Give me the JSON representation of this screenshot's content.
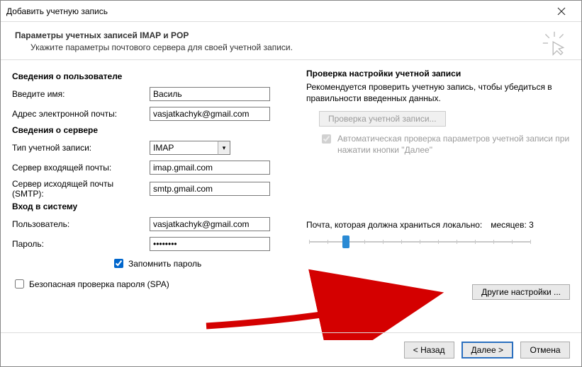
{
  "window_title": "Добавить учетную запись",
  "header": {
    "heading": "Параметры учетных записей IMAP и POP",
    "subheading": "Укажите параметры почтового сервера для своей учетной записи."
  },
  "left": {
    "user_section": "Сведения о пользователе",
    "name_label": "Введите имя:",
    "name_value": "Василь",
    "email_label": "Адрес электронной почты:",
    "email_value": "vasjatkachyk@gmail.com",
    "server_section": "Сведения о сервере",
    "account_type_label": "Тип учетной записи:",
    "account_type_value": "IMAP",
    "incoming_label": "Сервер входящей почты:",
    "incoming_value": "imap.gmail.com",
    "outgoing_label": "Сервер исходящей почты (SMTP):",
    "outgoing_value": "smtp.gmail.com",
    "login_section": "Вход в систему",
    "user_label": "Пользователь:",
    "user_value": "vasjatkachyk@gmail.com",
    "password_label": "Пароль:",
    "password_value": "********",
    "remember_label": "Запомнить пароль",
    "spa_label": "Безопасная проверка пароля (SPA)"
  },
  "right": {
    "test_title": "Проверка настройки учетной записи",
    "test_desc": "Рекомендуется проверить учетную запись, чтобы убедиться в правильности введенных данных.",
    "test_button": "Проверка учетной записи...",
    "auto_test_label": "Автоматическая проверка параметров учетной записи при нажатии кнопки \"Далее\"",
    "retention_label": "Почта, которая должна храниться локально:",
    "retention_value": "месяцев: 3",
    "more_button": "Другие настройки ..."
  },
  "footer": {
    "back": "< Назад",
    "next": "Далее >",
    "cancel": "Отмена"
  }
}
